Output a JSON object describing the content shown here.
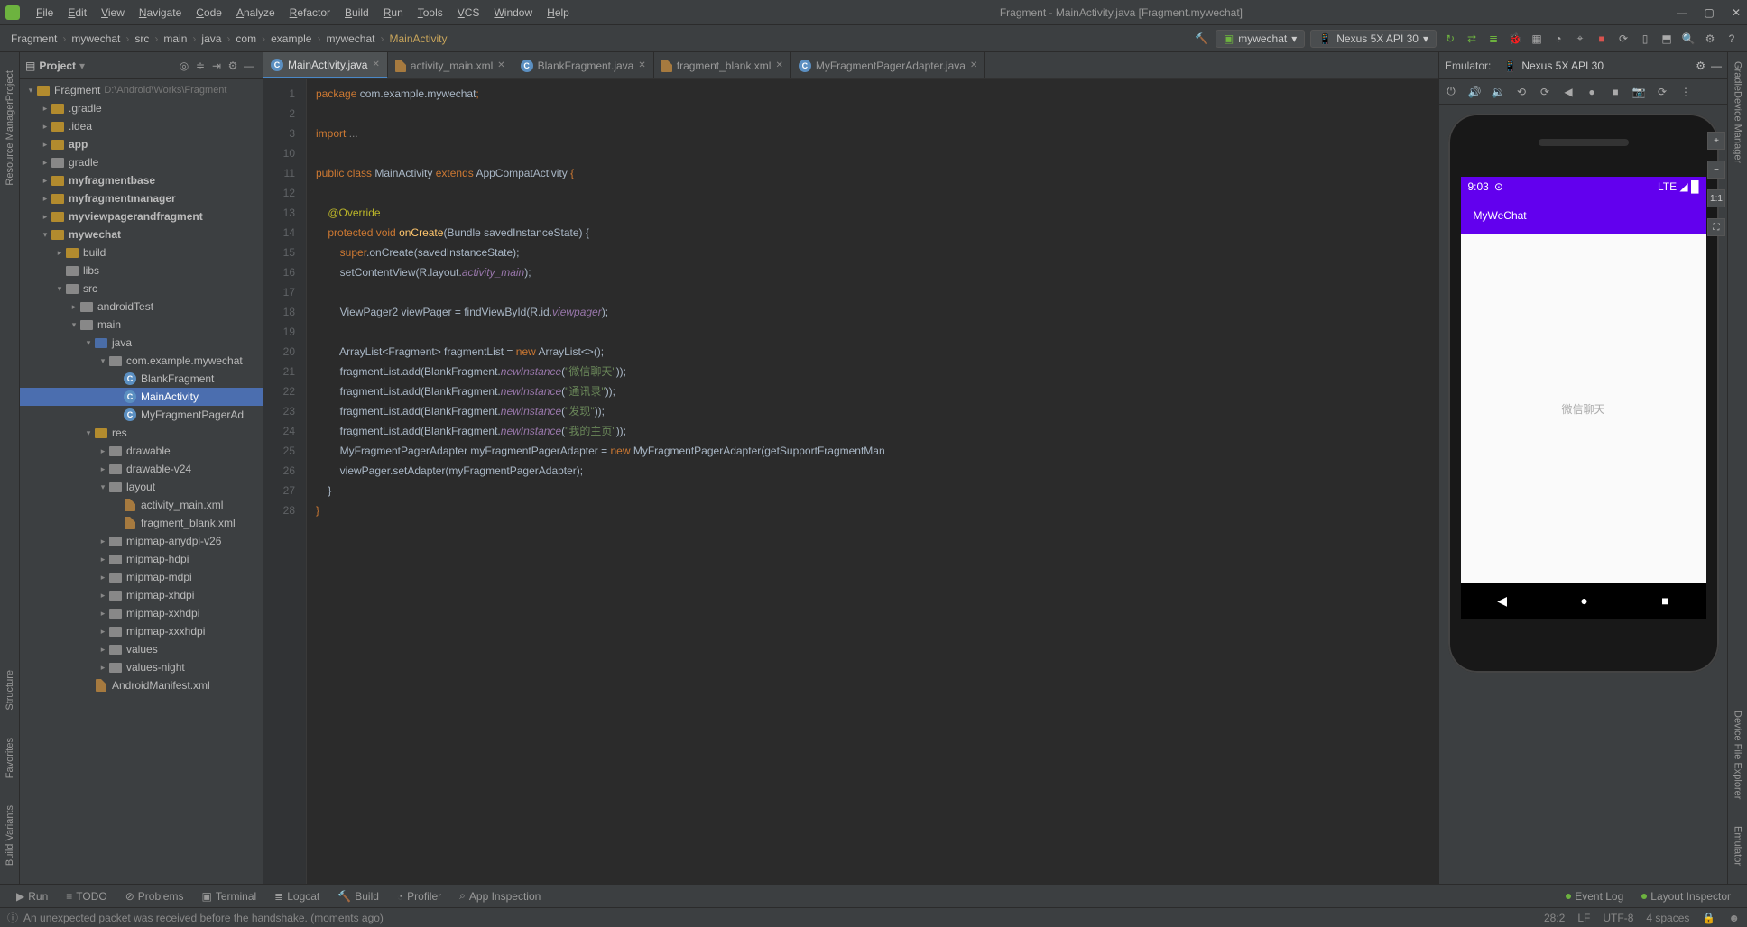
{
  "window_title": "Fragment - MainActivity.java [Fragment.mywechat]",
  "menus": [
    "File",
    "Edit",
    "View",
    "Navigate",
    "Code",
    "Analyze",
    "Refactor",
    "Build",
    "Run",
    "Tools",
    "VCS",
    "Window",
    "Help"
  ],
  "breadcrumbs": [
    "Fragment",
    "mywechat",
    "src",
    "main",
    "java",
    "com",
    "example",
    "mywechat",
    "MainActivity"
  ],
  "run_config": "mywechat",
  "device_target": "Nexus 5X API 30",
  "project": {
    "title": "Project",
    "root_name": "Fragment",
    "root_path": "D:\\Android\\Works\\Fragment"
  },
  "tree": [
    {
      "d": 0,
      "label": "Fragment",
      "path": "D:\\Android\\Works\\Fragment",
      "icon": "folder-y",
      "open": true
    },
    {
      "d": 1,
      "label": ".gradle",
      "icon": "folder-y",
      "collapsed": true
    },
    {
      "d": 1,
      "label": ".idea",
      "icon": "folder-y",
      "collapsed": true
    },
    {
      "d": 1,
      "label": "app",
      "icon": "folder-y",
      "collapsed": true,
      "bold": true
    },
    {
      "d": 1,
      "label": "gradle",
      "icon": "folder-g",
      "collapsed": true
    },
    {
      "d": 1,
      "label": "myfragmentbase",
      "icon": "folder-y",
      "collapsed": true,
      "bold": true
    },
    {
      "d": 1,
      "label": "myfragmentmanager",
      "icon": "folder-y",
      "collapsed": true,
      "bold": true
    },
    {
      "d": 1,
      "label": "myviewpagerandfragment",
      "icon": "folder-y",
      "collapsed": true,
      "bold": true
    },
    {
      "d": 1,
      "label": "mywechat",
      "icon": "folder-y",
      "open": true,
      "bold": true
    },
    {
      "d": 2,
      "label": "build",
      "icon": "folder-y",
      "collapsed": true
    },
    {
      "d": 2,
      "label": "libs",
      "icon": "folder-g",
      "leaf": true
    },
    {
      "d": 2,
      "label": "src",
      "icon": "folder-g",
      "open": true
    },
    {
      "d": 3,
      "label": "androidTest",
      "icon": "folder-g",
      "collapsed": true
    },
    {
      "d": 3,
      "label": "main",
      "icon": "folder-g",
      "open": true
    },
    {
      "d": 4,
      "label": "java",
      "icon": "folder-b",
      "open": true
    },
    {
      "d": 5,
      "label": "com.example.mywechat",
      "icon": "folder-g",
      "open": true
    },
    {
      "d": 6,
      "label": "BlankFragment",
      "icon": "class",
      "leaf": true
    },
    {
      "d": 6,
      "label": "MainActivity",
      "icon": "class",
      "selected": true,
      "leaf": true
    },
    {
      "d": 6,
      "label": "MyFragmentPagerAd",
      "icon": "class",
      "leaf": true
    },
    {
      "d": 4,
      "label": "res",
      "icon": "folder-y",
      "open": true
    },
    {
      "d": 5,
      "label": "drawable",
      "icon": "folder-g",
      "collapsed": true
    },
    {
      "d": 5,
      "label": "drawable-v24",
      "icon": "folder-g",
      "collapsed": true
    },
    {
      "d": 5,
      "label": "layout",
      "icon": "folder-g",
      "open": true
    },
    {
      "d": 6,
      "label": "activity_main.xml",
      "icon": "xml",
      "leaf": true
    },
    {
      "d": 6,
      "label": "fragment_blank.xml",
      "icon": "xml",
      "leaf": true
    },
    {
      "d": 5,
      "label": "mipmap-anydpi-v26",
      "icon": "folder-g",
      "collapsed": true
    },
    {
      "d": 5,
      "label": "mipmap-hdpi",
      "icon": "folder-g",
      "collapsed": true
    },
    {
      "d": 5,
      "label": "mipmap-mdpi",
      "icon": "folder-g",
      "collapsed": true
    },
    {
      "d": 5,
      "label": "mipmap-xhdpi",
      "icon": "folder-g",
      "collapsed": true
    },
    {
      "d": 5,
      "label": "mipmap-xxhdpi",
      "icon": "folder-g",
      "collapsed": true
    },
    {
      "d": 5,
      "label": "mipmap-xxxhdpi",
      "icon": "folder-g",
      "collapsed": true
    },
    {
      "d": 5,
      "label": "values",
      "icon": "folder-g",
      "collapsed": true
    },
    {
      "d": 5,
      "label": "values-night",
      "icon": "folder-g",
      "collapsed": true
    },
    {
      "d": 4,
      "label": "AndroidManifest.xml",
      "icon": "xml",
      "leaf": true
    }
  ],
  "tabs": [
    {
      "label": "MainActivity.java",
      "icon": "class",
      "active": true
    },
    {
      "label": "activity_main.xml",
      "icon": "xml"
    },
    {
      "label": "BlankFragment.java",
      "icon": "class"
    },
    {
      "label": "fragment_blank.xml",
      "icon": "xml"
    },
    {
      "label": "MyFragmentPagerAdapter.java",
      "icon": "class"
    }
  ],
  "code_lines": [
    {
      "n": 1,
      "html": "<span class='kw'>package</span> com.example.mywechat<span class='kw'>;</span>"
    },
    {
      "n": 2,
      "html": ""
    },
    {
      "n": 3,
      "html": "<span class='kw'>import</span> <span class='com'>...</span>"
    },
    {
      "n": 10,
      "html": ""
    },
    {
      "n": 11,
      "html": "<span class='kw'>public class</span> <span class='cls'>MainActivity</span> <span class='kw'>extends</span> AppCompatActivity <span class='kw'>{</span>"
    },
    {
      "n": 12,
      "html": ""
    },
    {
      "n": 13,
      "html": "    <span class='ann'>@Override</span>"
    },
    {
      "n": 14,
      "html": "    <span class='kw'>protected void</span> <span class='mth'>onCreate</span>(Bundle savedInstanceState) {"
    },
    {
      "n": 15,
      "html": "        <span class='kw'>super</span>.onCreate(savedInstanceState);"
    },
    {
      "n": 16,
      "html": "        setContentView(R.layout.<span class='fld'>activity_main</span>);"
    },
    {
      "n": 17,
      "html": ""
    },
    {
      "n": 18,
      "html": "        ViewPager2 viewPager = findViewById(R.id.<span class='fld'>viewpager</span>);"
    },
    {
      "n": 19,
      "html": ""
    },
    {
      "n": 20,
      "html": "        ArrayList&lt;Fragment&gt; fragmentList = <span class='kw'>new</span> ArrayList&lt;&gt;();"
    },
    {
      "n": 21,
      "html": "        fragmentList.add(BlankFragment.<span class='fld'>newInstance</span>(<span class='str'>\"微信聊天\"</span>));"
    },
    {
      "n": 22,
      "html": "        fragmentList.add(BlankFragment.<span class='fld'>newInstance</span>(<span class='str'>\"通讯录\"</span>));"
    },
    {
      "n": 23,
      "html": "        fragmentList.add(BlankFragment.<span class='fld'>newInstance</span>(<span class='str'>\"发现\"</span>));"
    },
    {
      "n": 24,
      "html": "        fragmentList.add(BlankFragment.<span class='fld'>newInstance</span>(<span class='str'>\"我的主页\"</span>));"
    },
    {
      "n": 25,
      "html": "        MyFragmentPagerAdapter myFragmentPagerAdapter = <span class='kw'>new</span> MyFragmentPagerAdapter(getSupportFragmentMan"
    },
    {
      "n": 26,
      "html": "        viewPager.setAdapter(myFragmentPagerAdapter);"
    },
    {
      "n": 27,
      "html": "    }"
    },
    {
      "n": 28,
      "html": "<span class='kw'>}</span>"
    }
  ],
  "emulator": {
    "label": "Emulator:",
    "device": "Nexus 5X API 30",
    "status_time": "9:03",
    "status_right": "LTE ◢ █",
    "app_title": "MyWeChat",
    "content_text": "微信聊天",
    "zoom_buttons": [
      "+",
      "−",
      "1:1",
      "⛶"
    ]
  },
  "bottom_tools": [
    "Run",
    "TODO",
    "Problems",
    "Terminal",
    "Logcat",
    "Build",
    "Profiler",
    "App Inspection"
  ],
  "bottom_right": [
    "Event Log",
    "Layout Inspector"
  ],
  "status_msg": "An unexpected packet was received before the handshake. (moments ago)",
  "status_right": [
    "28:2",
    "LF",
    "UTF-8",
    "4 spaces"
  ],
  "left_rails": [
    "Project",
    "Resource Manager"
  ],
  "left_rails_bottom": [
    "Structure",
    "Favorites",
    "Build Variants"
  ],
  "right_rails": [
    "Gradle",
    "Device Manager"
  ],
  "right_rails_bottom": [
    "Device File Explorer",
    "Emulator"
  ]
}
